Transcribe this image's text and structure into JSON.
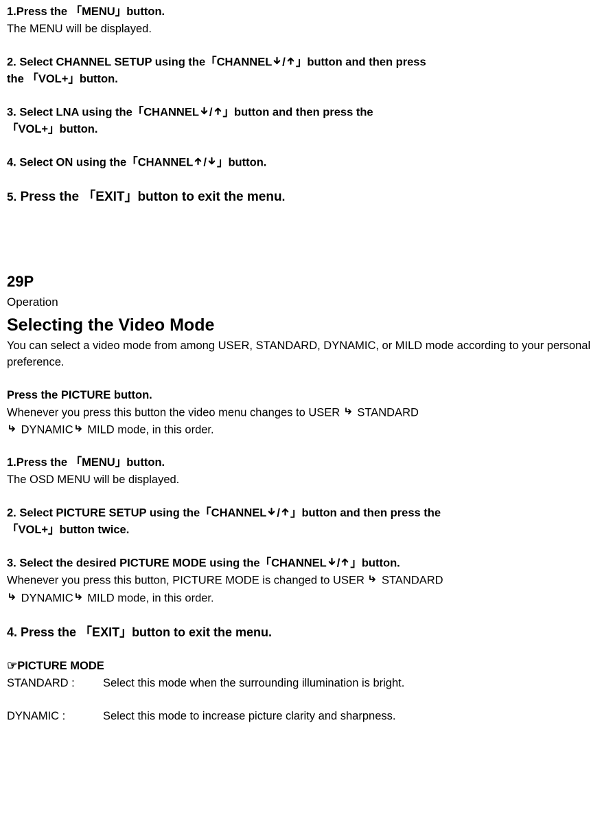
{
  "step1": {
    "prefix": "1.Press the 「MENU」button.",
    "sub": "The MENU will be displayed."
  },
  "step2": {
    "part1": "2. Select CHANNEL SETUP using the「CHANNEL",
    "part2": "/",
    "part3": "」button and then press",
    "line2": "the 「VOL+」button."
  },
  "step3": {
    "part1": "3. Select LNA using the「CHANNEL",
    "part2": "/",
    "part3": "」button and then press the",
    "line2": "「VOL+」button."
  },
  "step4": {
    "part1": "4. Select ON using the「CHANNEL",
    "part2": "/",
    "part3": "」button."
  },
  "step5": {
    "prefix": "5.",
    "rest": "Press the 「EXIT」button to exit the menu",
    "dot": "."
  },
  "page_num": "29P",
  "operation_label": "Operation",
  "heading": "Selecting the Video Mode",
  "intro": "You can select a video mode from among USER, STANDARD, DYNAMIC, or MILD mode according to your personal preference.",
  "picture_btn": {
    "title": "Press the PICTURE button.",
    "desc1a": "Whenever you press this button the video menu changes to USER ",
    "desc1b": " STANDARD",
    "desc2a": " DYNAMIC",
    "desc2b": " MILD mode, in this order."
  },
  "vm_step1": {
    "title": "1.Press the 「MENU」button.",
    "sub": "The OSD MENU will be displayed."
  },
  "vm_step2": {
    "part1": "2. Select PICTURE SETUP using the「CHANNEL",
    "part2": "/",
    "part3": "」button and then press the",
    "line2": "「VOL+」button twice."
  },
  "vm_step3": {
    "part1": "3. Select the desired PICTURE MODE using the「CHANNEL",
    "part2": "/",
    "part3": "」button.",
    "desc1a": " Whenever you press this button, PICTURE MODE is changed to USER ",
    "desc1b": " STANDARD",
    "desc2a": " DYNAMIC",
    "desc2b": " MILD mode, in this order."
  },
  "vm_step4": "4. Press the 「EXIT」button to exit the menu.",
  "modes": {
    "title": "PICTURE MODE",
    "standard_label": "STANDARD :",
    "standard_desc": "Select this mode when the surrounding illumination is bright.",
    "dynamic_label": "DYNAMIC :",
    "dynamic_desc": "Select this mode to increase picture clarity and sharpness."
  }
}
